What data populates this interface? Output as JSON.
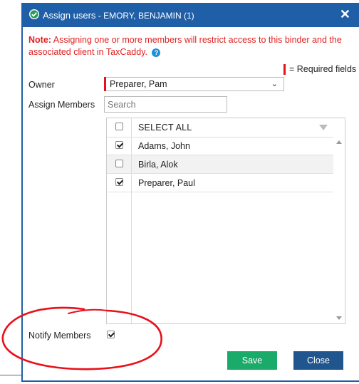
{
  "dialog": {
    "title": "Assign users",
    "subtitle": " - EMORY, BENJAMIN (1)",
    "close_label": "✕"
  },
  "note": {
    "prefix": "Note:",
    "text": " Assigning one or more members will restrict access to this binder and the associated client in TaxCaddy.",
    "help_label": "?"
  },
  "required_legend": "= Required fields",
  "owner": {
    "label": "Owner",
    "value": "Preparer, Pam"
  },
  "assign_members": {
    "label": "Assign Members",
    "search_placeholder": "Search"
  },
  "members_grid": {
    "header": "SELECT ALL",
    "select_all_checked": false,
    "rows": [
      {
        "name": "Adams, John",
        "checked": true
      },
      {
        "name": "Birla, Alok",
        "checked": false
      },
      {
        "name": "Preparer, Paul",
        "checked": true
      }
    ]
  },
  "notify": {
    "label": "Notify Members",
    "checked": true
  },
  "buttons": {
    "save": "Save",
    "close": "Close"
  },
  "colors": {
    "titlebar": "#1f5fa8",
    "note_text": "#e02020",
    "required_marker": "#e8101a",
    "save_button": "#1aaa6a",
    "close_button": "#20558d",
    "annotation_circle": "#e8101a"
  },
  "icons": {
    "title": "check-circle-icon",
    "close": "close-icon",
    "help": "help-icon",
    "owner_dropdown": "chevron-down-icon",
    "grid_filter": "filter-icon"
  }
}
